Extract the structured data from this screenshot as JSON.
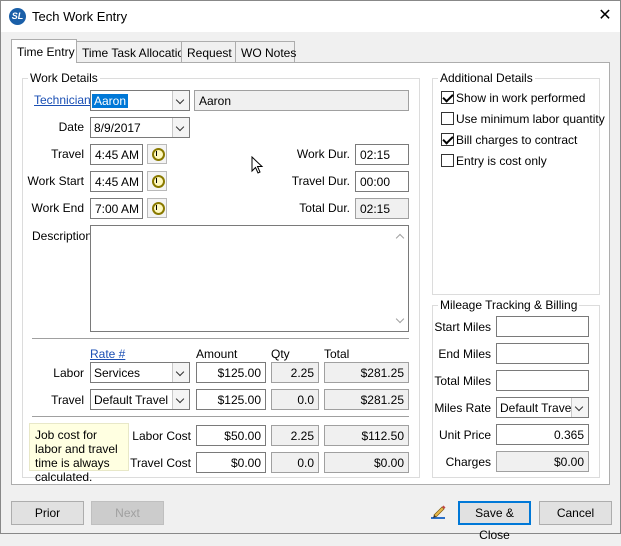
{
  "window": {
    "title": "Tech Work Entry",
    "app_icon": "SL",
    "close_glyph": "✕"
  },
  "tabs": [
    {
      "label": "Time Entry",
      "active": true
    },
    {
      "label": "Time Task Allocation",
      "active": false
    },
    {
      "label": "Request",
      "active": false
    },
    {
      "label": "WO Notes",
      "active": false
    }
  ],
  "work_details": {
    "group_label": "Work Details",
    "technician_label": "Technician",
    "technician_value": "Aaron",
    "technician_name": "Aaron",
    "date_label": "Date",
    "date_value": "8/9/2017",
    "travel_label": "Travel",
    "travel_value": "4:45 AM",
    "work_start_label": "Work Start",
    "work_start_value": "4:45 AM",
    "work_end_label": "Work End",
    "work_end_value": "7:00 AM",
    "work_dur_label": "Work Dur.",
    "work_dur_value": "02:15",
    "travel_dur_label": "Travel Dur.",
    "travel_dur_value": "00:00",
    "total_dur_label": "Total Dur.",
    "total_dur_value": "02:15",
    "description_label": "Description",
    "description_value": ""
  },
  "rates": {
    "rate_header": "Rate #",
    "amount_header": "Amount",
    "qty_header": "Qty",
    "total_header": "Total",
    "labor": {
      "label": "Labor",
      "rate": "Services",
      "amount": "$125.00",
      "qty": "2.25",
      "total": "$281.25"
    },
    "travel": {
      "label": "Travel",
      "rate": "Default Travel",
      "amount": "$125.00",
      "qty": "0.0",
      "total": "$281.25"
    },
    "labor_cost": {
      "label": "Labor Cost",
      "amount": "$50.00",
      "qty": "2.25",
      "total": "$112.50"
    },
    "travel_cost": {
      "label": "Travel Cost",
      "amount": "$0.00",
      "qty": "0.0",
      "total": "$0.00"
    },
    "note": "Job cost for labor and travel time is always calculated."
  },
  "additional_details": {
    "group_label": "Additional Details",
    "options": [
      {
        "label": "Show in work performed",
        "checked": true
      },
      {
        "label": "Use minimum labor quantity",
        "checked": false
      },
      {
        "label": "Bill charges to contract",
        "checked": true
      },
      {
        "label": "Entry is cost only",
        "checked": false
      }
    ]
  },
  "mileage": {
    "group_label": "Mileage Tracking & Billing",
    "start_label": "Start Miles",
    "start_value": "",
    "end_label": "End Miles",
    "end_value": "",
    "total_label": "Total Miles",
    "total_value": "",
    "rate_label": "Miles Rate",
    "rate_value": "Default Travel",
    "unit_price_label": "Unit Price",
    "unit_price_value": "0.365",
    "charges_label": "Charges",
    "charges_value": "$0.00"
  },
  "buttons": {
    "prior": "Prior",
    "next": "Next",
    "save_close": "Save & Close",
    "cancel": "Cancel"
  },
  "colors": {
    "accent": "#0078d7",
    "link": "#1a4fb4",
    "note_bg": "#ffffe1"
  }
}
